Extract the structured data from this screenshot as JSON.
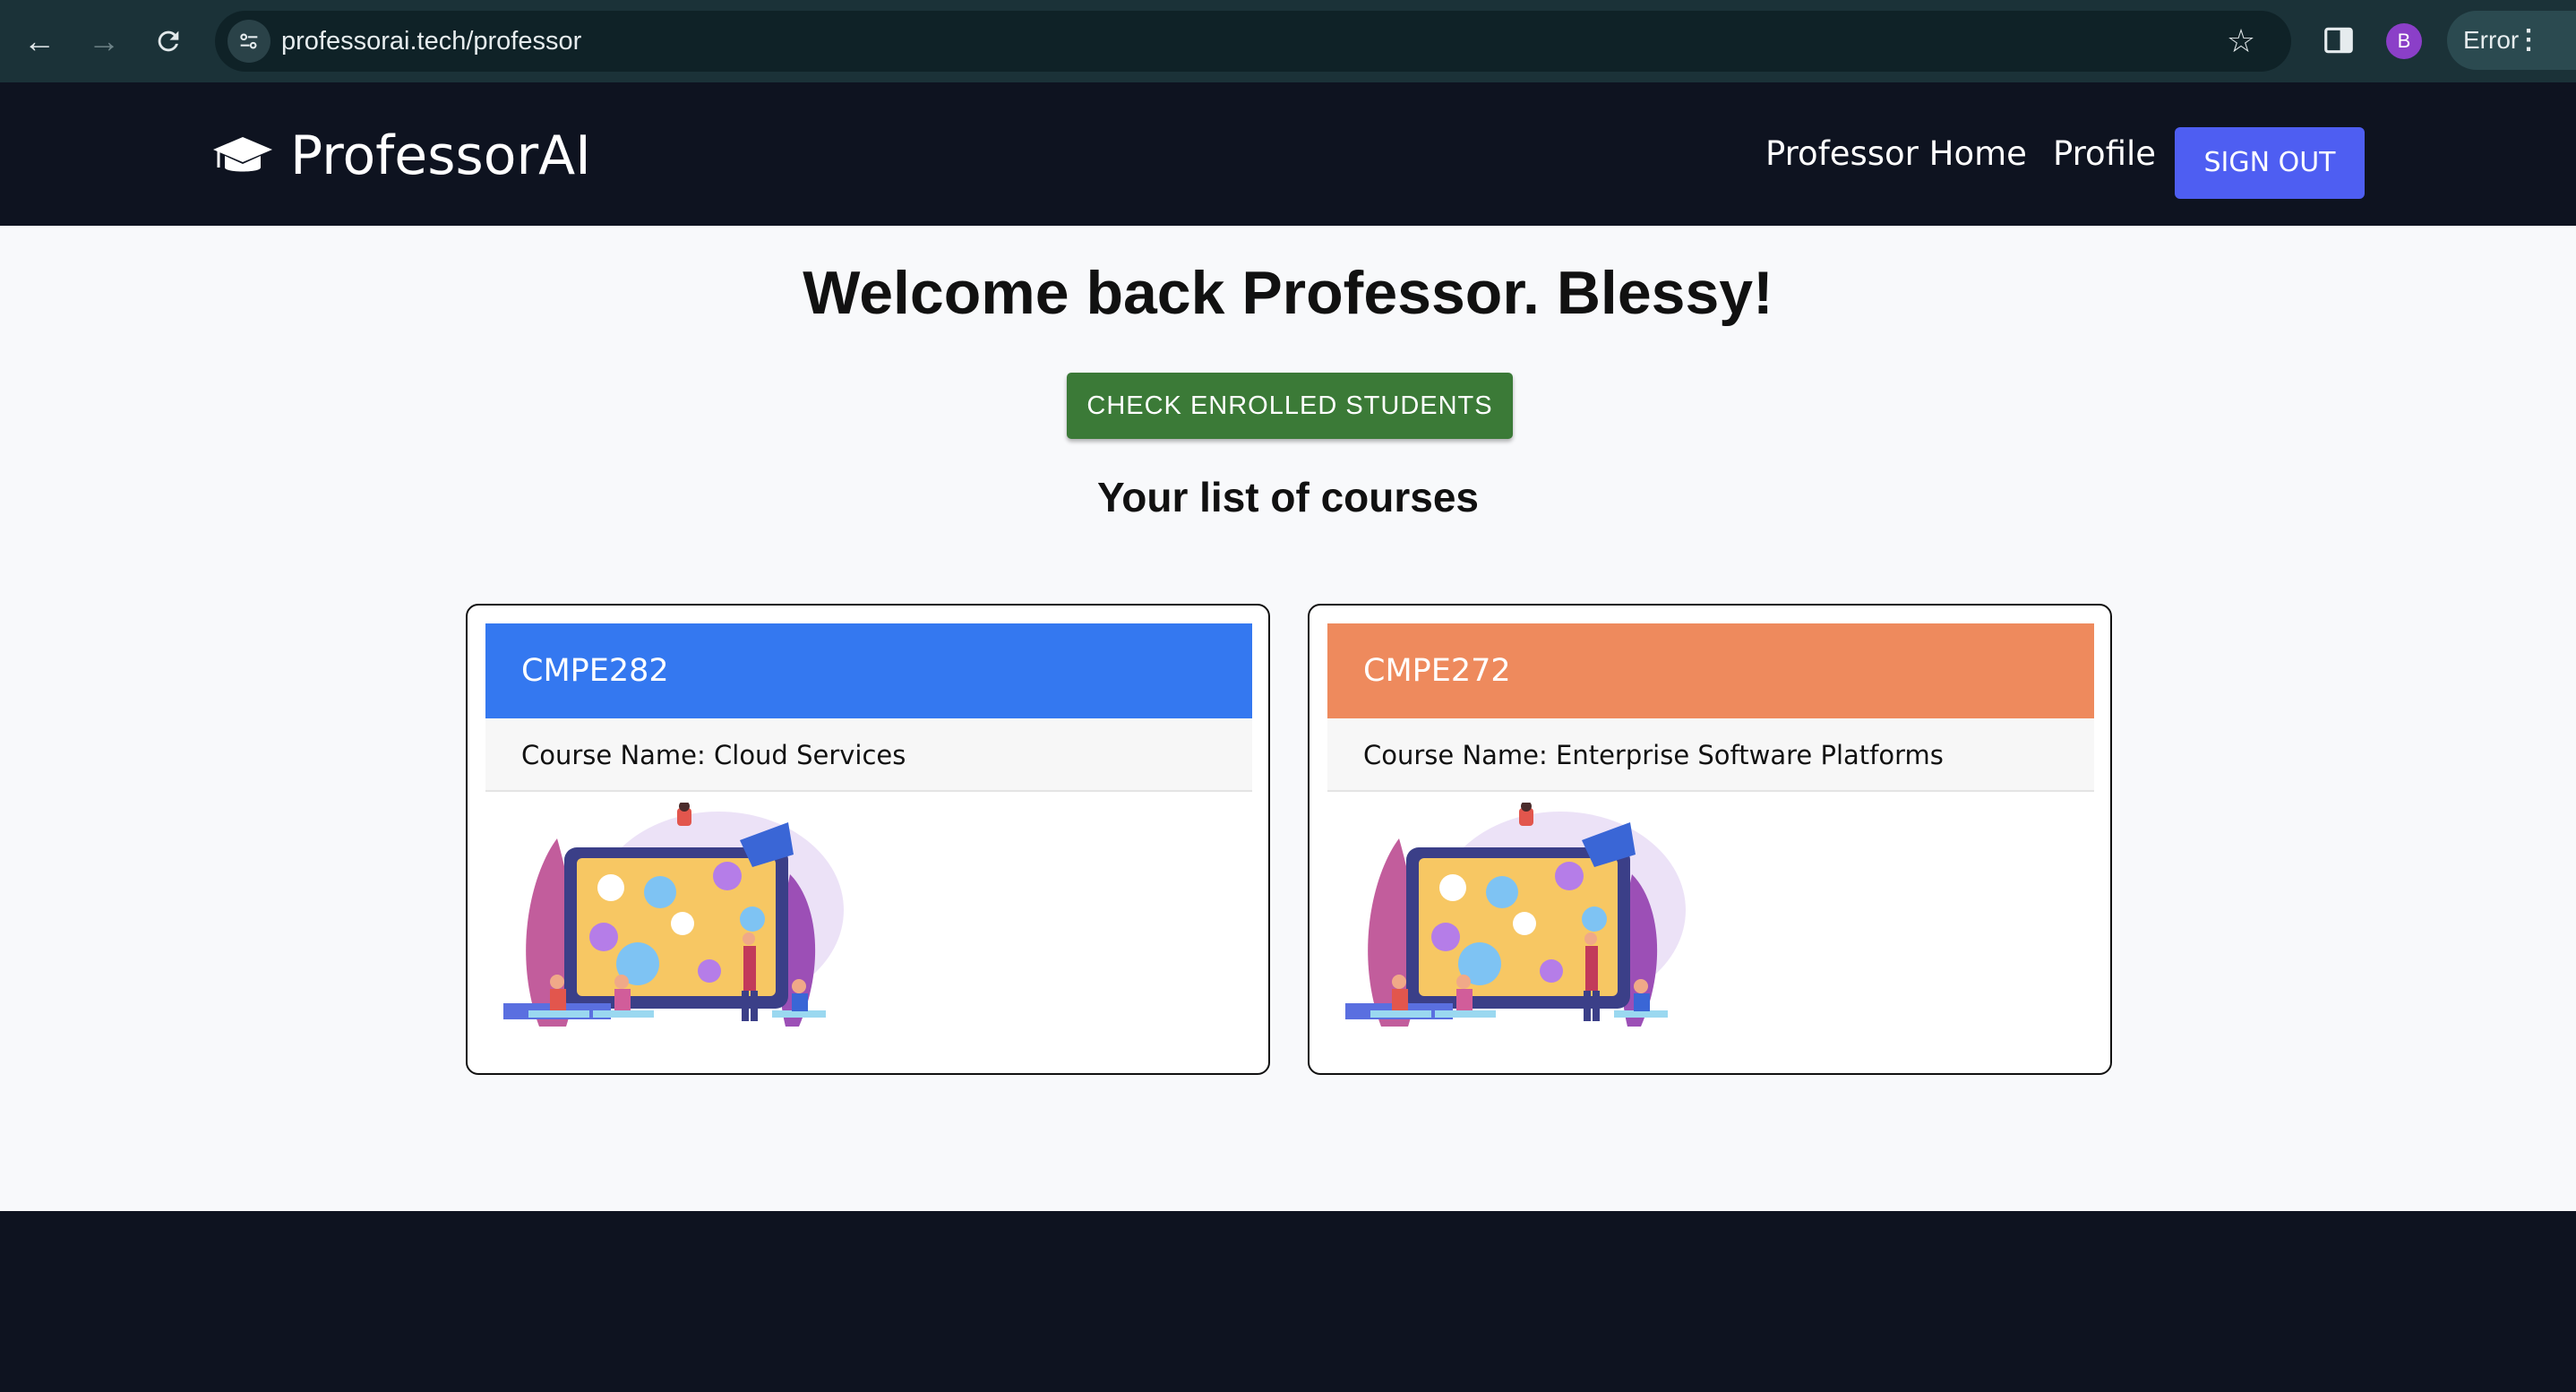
{
  "browser": {
    "url": "professorai.tech/professor",
    "profile_initial": "B",
    "error_label": "Error"
  },
  "navbar": {
    "brand": "ProfessorAI",
    "links": [
      "Professor Home",
      "Profile"
    ],
    "signout_label": "SIGN OUT"
  },
  "main": {
    "welcome": "Welcome back Professor. Blessy!",
    "check_button": "CHECK ENROLLED STUDENTS",
    "list_title": "Your list of courses"
  },
  "courses": [
    {
      "code": "CMPE282",
      "name": "Course Name: Cloud Services",
      "color": "#3478f0"
    },
    {
      "code": "CMPE272",
      "name": "Course Name: Enterprise Software Platforms",
      "color": "#ee8a5d"
    }
  ],
  "colors": {
    "navbar_bg": "#0e1320",
    "signout_bg": "#4e5ef2",
    "check_btn_bg": "#3b7a37"
  }
}
